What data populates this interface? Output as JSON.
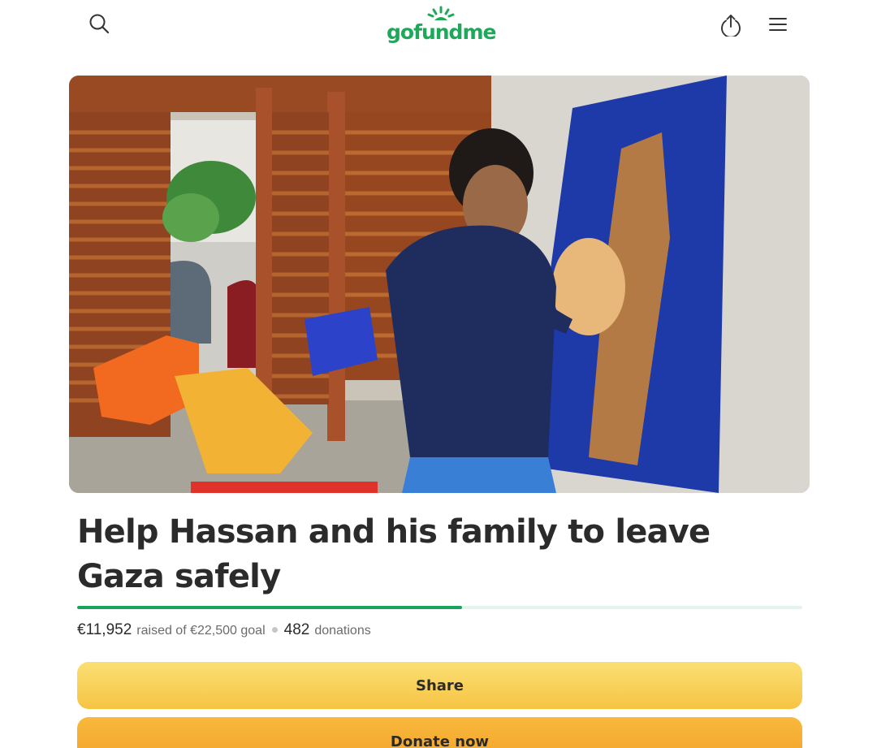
{
  "header": {
    "logo_text": "gofundme",
    "brand_color": "#1ea85a",
    "icons": {
      "search": "search-icon",
      "share": "share-upload-icon",
      "menu": "hamburger-menu-icon"
    }
  },
  "campaign": {
    "title": "Help Hassan and his family to leave Gaza safely",
    "image_alt": "Young man painting a blue canvas",
    "raised": "€11,952",
    "raised_suffix": "raised of €22,500 goal",
    "donations_count": "482",
    "donations_label": "donations",
    "progress_fraction": 0.531
  },
  "actions": {
    "share_label": "Share",
    "donate_label": "Donate now"
  }
}
